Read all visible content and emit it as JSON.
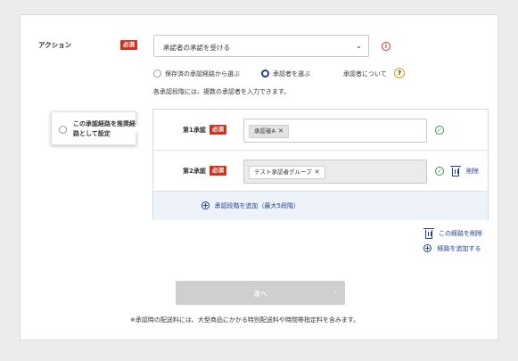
{
  "action": {
    "label": "アクション",
    "required_badge": "必須",
    "select_value": "承認者の承認を受ける",
    "alert_glyph": "!"
  },
  "approver_mode": {
    "option_saved": "保存済の承認経路から選ぶ",
    "option_select": "承認者を選ぶ",
    "selected": "承認者を選ぶ",
    "about_link": "承認者について",
    "help_glyph": "?"
  },
  "hint": "各承認段階には、複数の承認者を入力できます。",
  "recommend_route": {
    "label": "この承認経路を推奨経路として設定"
  },
  "steps": [
    {
      "label": "第1承認",
      "badge": "必須",
      "chip": "承認者A"
    },
    {
      "label": "第2承認",
      "badge": "必須",
      "chip": "テスト承認者グループ",
      "delete": "削除"
    }
  ],
  "add_step": "承認段階を追加（最大5段階）",
  "route_actions": {
    "delete_route": "この経路を削除",
    "add_route": "経路を追加する"
  },
  "next_button": {
    "label": "次へ",
    "arrow": "›"
  },
  "footnote": "※承認時の配送料には、大型商品にかかる特別配送料や時間帯指定料を含みます。",
  "colors": {
    "accent": "#1f3c94",
    "required": "#d0311e",
    "success": "#2e9e46",
    "disabled": "#cfcfcf"
  }
}
